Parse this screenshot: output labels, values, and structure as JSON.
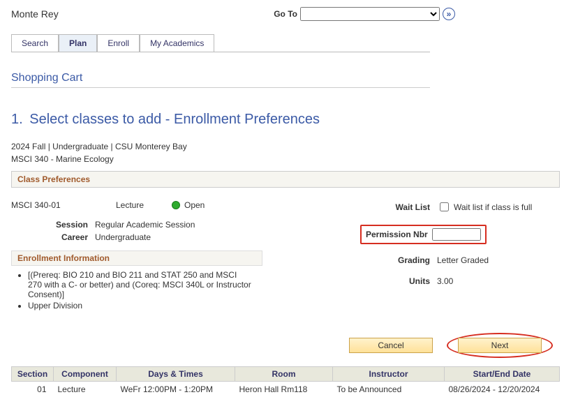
{
  "header": {
    "user_name": "Monte Rey",
    "goto_label": "Go To",
    "goto_value": ""
  },
  "tabs": [
    {
      "label": "Search",
      "active": false
    },
    {
      "label": "Plan",
      "active": true
    },
    {
      "label": "Enroll",
      "active": false
    },
    {
      "label": "My Academics",
      "active": false
    }
  ],
  "section_title": "Shopping Cart",
  "page": {
    "number": "1.",
    "title": "Select classes to add - Enrollment Preferences",
    "term_line": "2024 Fall | Undergraduate | CSU Monterey Bay",
    "course_line": "MSCI  340 - Marine Ecology"
  },
  "class_preferences": {
    "bar": "Class Preferences",
    "class_id": "MSCI 340-01",
    "component": "Lecture",
    "status_text": "Open",
    "session_label": "Session",
    "session_value": "Regular Academic Session",
    "career_label": "Career",
    "career_value": "Undergraduate",
    "enrollment_info_bar": "Enrollment Information",
    "requirements": [
      "[(Prereq: BIO 210 and BIO 211 and STAT 250 and MSCI 270  with a C- or better) and (Coreq: MSCI 340L or Instructor Consent)]",
      "Upper Division"
    ]
  },
  "right": {
    "waitlist_label": "Wait List",
    "waitlist_checkbox_label": "Wait list if class is full",
    "waitlist_checked": false,
    "permission_label": "Permission Nbr",
    "permission_value": "",
    "grading_label": "Grading",
    "grading_value": "Letter Graded",
    "units_label": "Units",
    "units_value": "3.00"
  },
  "buttons": {
    "cancel": "Cancel",
    "next": "Next"
  },
  "table": {
    "headers": {
      "section": "Section",
      "component": "Component",
      "days_times": "Days & Times",
      "room": "Room",
      "instructor": "Instructor",
      "start_end": "Start/End Date"
    },
    "rows": [
      {
        "section": "01",
        "component": "Lecture",
        "days_times": "WeFr 12:00PM - 1:20PM",
        "room": "Heron Hall Rm118",
        "instructor": "To be Announced",
        "start_end": "08/26/2024 - 12/20/2024"
      }
    ]
  }
}
